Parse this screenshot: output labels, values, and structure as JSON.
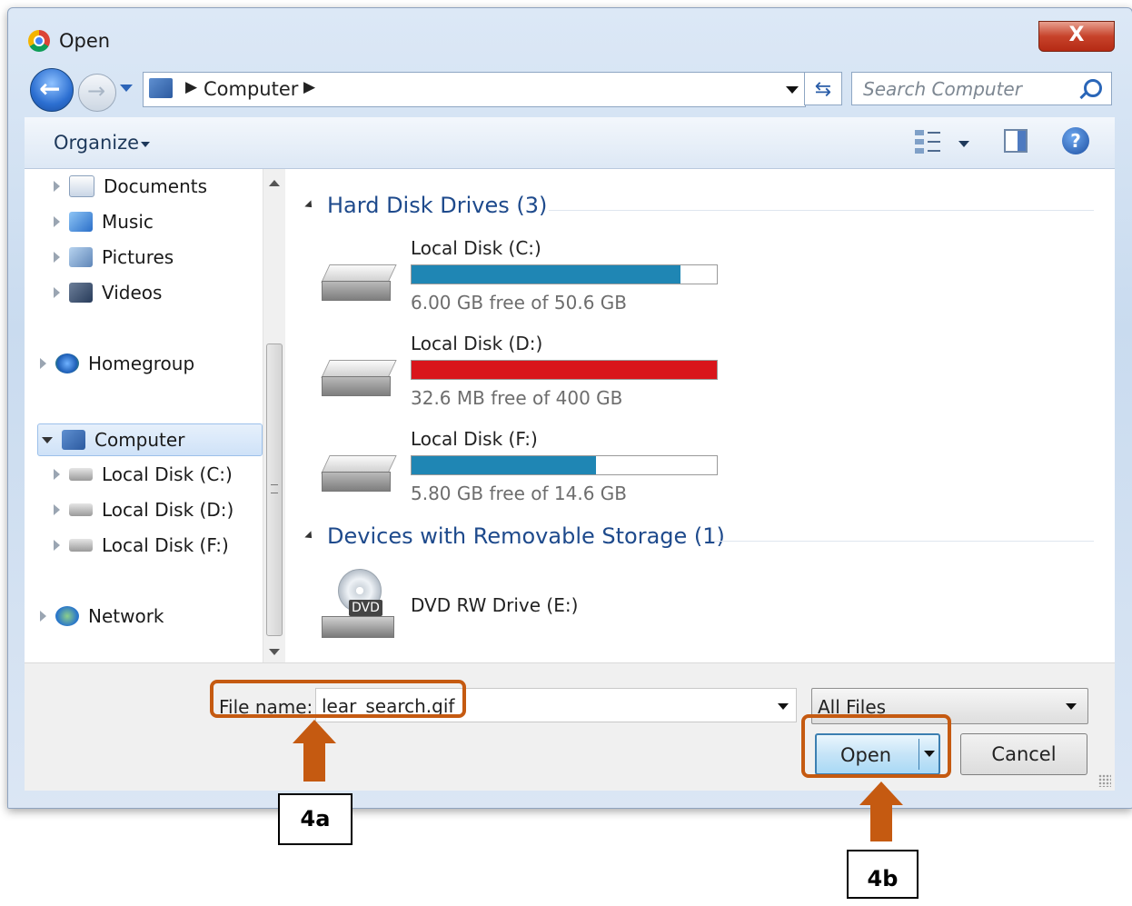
{
  "window": {
    "title": "Open",
    "close_label": "X"
  },
  "address": {
    "location": "Computer",
    "search_placeholder": "Search Computer"
  },
  "toolbar": {
    "organize_label": "Organize"
  },
  "nav": {
    "items": [
      {
        "label": "Documents",
        "icon": "documents-icon"
      },
      {
        "label": "Music",
        "icon": "music-icon"
      },
      {
        "label": "Pictures",
        "icon": "pictures-icon"
      },
      {
        "label": "Videos",
        "icon": "videos-icon"
      },
      {
        "label": "Homegroup",
        "icon": "homegroup-icon"
      },
      {
        "label": "Computer",
        "icon": "computer-icon"
      },
      {
        "label": "Local Disk (C:)",
        "icon": "drive-icon"
      },
      {
        "label": "Local Disk (D:)",
        "icon": "drive-icon"
      },
      {
        "label": "Local Disk (F:)",
        "icon": "drive-icon"
      },
      {
        "label": "Network",
        "icon": "network-icon"
      }
    ]
  },
  "content": {
    "groups": [
      {
        "title": "Hard Disk Drives (3)"
      },
      {
        "title": "Devices with Removable Storage (1)"
      }
    ],
    "drives": [
      {
        "label": "Local Disk (C:)",
        "free_text": "6.00 GB free of 50.6 GB",
        "used_fraction": 0.881,
        "bar_color": "#1f86b4"
      },
      {
        "label": "Local Disk (D:)",
        "free_text": "32.6 MB free of 400 GB",
        "used_fraction": 0.9999,
        "bar_color": "#d9151b"
      },
      {
        "label": "Local Disk (F:)",
        "free_text": "5.80 GB free of 14.6 GB",
        "used_fraction": 0.603,
        "bar_color": "#1f86b4"
      }
    ],
    "removable": {
      "label": "DVD RW Drive (E:)",
      "badge": "DVD"
    }
  },
  "footer": {
    "filename_label": "File name:",
    "filename_value": "lear_search.gif",
    "filetype_value": "All Files",
    "open_label": "Open",
    "cancel_label": "Cancel"
  },
  "annotations": {
    "step_a": "4a",
    "step_b": "4b",
    "accent_color": "#c55a11"
  }
}
